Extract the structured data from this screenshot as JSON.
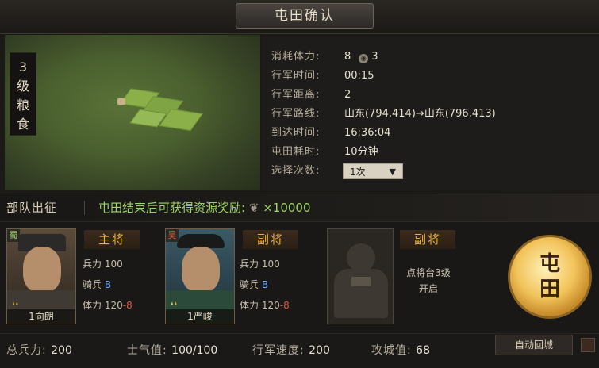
{
  "header": {
    "title": "屯田确认"
  },
  "map": {
    "level_tag": [
      "3",
      "级",
      "粮",
      "食"
    ]
  },
  "info": {
    "stamina": {
      "label": "消耗体力:",
      "value": "8",
      "extra": "3"
    },
    "march_time": {
      "label": "行军时间:",
      "value": "00:15"
    },
    "march_distance": {
      "label": "行军距离:",
      "value": "2"
    },
    "march_route": {
      "label": "行军路线:",
      "from": "山东(794,414)",
      "arrow": "→",
      "to": "山东(796,413)"
    },
    "arrive_time": {
      "label": "到达时间:",
      "value": "16:36:04"
    },
    "farm_time": {
      "label": "屯田耗时:",
      "value": "10分钟"
    },
    "times": {
      "label": "选择次数:",
      "value": "1次"
    }
  },
  "bar": {
    "deploy": "部队出征",
    "reward": "屯田结束后可获得资源奖励:",
    "reward_amount": "×10000"
  },
  "generals": [
    {
      "faction": "蜀",
      "name": "1向朗",
      "role": "主将",
      "troops_label": "兵力",
      "troops": "100",
      "type_label": "骑兵",
      "type_grade": "B",
      "stamina_label": "体力",
      "stamina": "120",
      "stamina_cost": "-8"
    },
    {
      "faction": "吴",
      "name": "1严峻",
      "role": "副将",
      "troops_label": "兵力",
      "troops": "100",
      "type_label": "骑兵",
      "type_grade": "B",
      "stamina_label": "体力",
      "stamina": "120",
      "stamina_cost": "-8"
    }
  ],
  "empty_slot": {
    "role": "副将",
    "unlock_line1": "点将台3级",
    "unlock_line2": "开启"
  },
  "go_button": {
    "line1": "屯",
    "line2": "田"
  },
  "footer": {
    "total_troops": {
      "label": "总兵力:",
      "value": "200"
    },
    "morale": {
      "label": "士气值:",
      "value": "100/100"
    },
    "speed": {
      "label": "行军速度:",
      "value": "200"
    },
    "siege": {
      "label": "攻城值:",
      "value": "68"
    },
    "auto_return": "自动回城"
  },
  "colors": {
    "accent_green": "#9fd36b",
    "accent_gold": "#e8b04a",
    "grade_blue": "#6fa8ff",
    "cost_red": "#e0573f"
  },
  "icons": {
    "stamina": "stamina-icon",
    "reward": "grain-icon",
    "dropdown": "caret-down-icon"
  }
}
